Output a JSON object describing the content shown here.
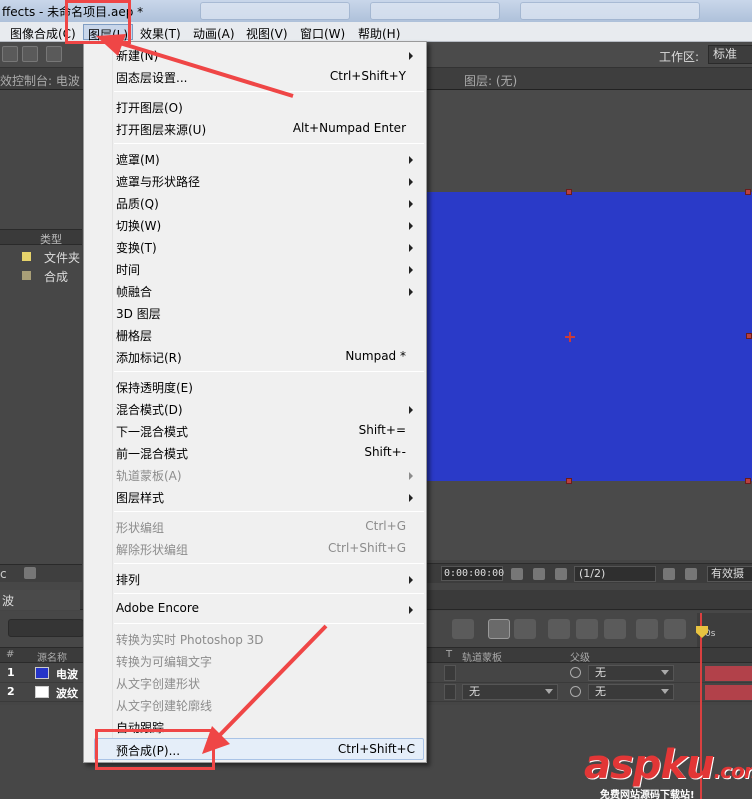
{
  "window": {
    "title": "ffects - 未命名项目.aep *"
  },
  "menubar": {
    "items": [
      "图像合成(C)",
      "图层(L)",
      "效果(T)",
      "动画(A)",
      "视图(V)",
      "窗口(W)",
      "帮助(H)"
    ]
  },
  "toolbar": {
    "workspace_label": "工作区:",
    "workspace_value": "标准"
  },
  "panels": {
    "effect_controls_label": "效控制台: 电波",
    "layer_label": "图层: (无)"
  },
  "project": {
    "type_header": "类型",
    "items": [
      {
        "name": "文件夹",
        "swatch": "#e6d36b"
      },
      {
        "name": "合成",
        "swatch": "#a99f78"
      }
    ],
    "footer_text": "c"
  },
  "viewer": {
    "timecode": "0:00:00:00",
    "resolution": "(1/2)",
    "camera_label": "有效摄"
  },
  "timeline": {
    "tab_label": "波",
    "headers": {
      "num": "#",
      "source_name": "源名称",
      "track_matte": "轨道蒙板",
      "parent": "父级",
      "t": "T"
    },
    "rows": [
      {
        "num": "1",
        "name": "电波",
        "color": "#2534c8",
        "matte": "",
        "parent": "无"
      },
      {
        "num": "2",
        "name": "波纹",
        "color": "#ffffff",
        "matte": "无",
        "parent": "无"
      }
    ],
    "ruler_label": "0s"
  },
  "layer_menu": {
    "items": [
      {
        "label": "新建(N)",
        "shortcut": "",
        "submenu": true,
        "disabled": false
      },
      {
        "label": "固态层设置...",
        "shortcut": "Ctrl+Shift+Y",
        "submenu": false,
        "disabled": false
      },
      {
        "sep": true
      },
      {
        "label": "打开图层(O)",
        "shortcut": "",
        "submenu": false,
        "disabled": false
      },
      {
        "label": "打开图层来源(U)",
        "shortcut": "Alt+Numpad Enter",
        "submenu": false,
        "disabled": false
      },
      {
        "sep": true
      },
      {
        "label": "遮罩(M)",
        "shortcut": "",
        "submenu": true,
        "disabled": false
      },
      {
        "label": "遮罩与形状路径",
        "shortcut": "",
        "submenu": true,
        "disabled": false
      },
      {
        "label": "品质(Q)",
        "shortcut": "",
        "submenu": true,
        "disabled": false
      },
      {
        "label": "切换(W)",
        "shortcut": "",
        "submenu": true,
        "disabled": false
      },
      {
        "label": "变换(T)",
        "shortcut": "",
        "submenu": true,
        "disabled": false
      },
      {
        "label": "时间",
        "shortcut": "",
        "submenu": true,
        "disabled": false
      },
      {
        "label": "帧融合",
        "shortcut": "",
        "submenu": true,
        "disabled": false
      },
      {
        "label": "3D 图层",
        "shortcut": "",
        "submenu": false,
        "disabled": false
      },
      {
        "label": "栅格层",
        "shortcut": "",
        "submenu": false,
        "disabled": false
      },
      {
        "label": "添加标记(R)",
        "shortcut": "Numpad *",
        "submenu": false,
        "disabled": false
      },
      {
        "sep": true
      },
      {
        "label": "保持透明度(E)",
        "shortcut": "",
        "submenu": false,
        "disabled": false
      },
      {
        "label": "混合模式(D)",
        "shortcut": "",
        "submenu": true,
        "disabled": false
      },
      {
        "label": "下一混合模式",
        "shortcut": "Shift+=",
        "submenu": false,
        "disabled": false
      },
      {
        "label": "前一混合模式",
        "shortcut": "Shift+-",
        "submenu": false,
        "disabled": false
      },
      {
        "label": "轨道蒙板(A)",
        "shortcut": "",
        "submenu": true,
        "disabled": true
      },
      {
        "label": "图层样式",
        "shortcut": "",
        "submenu": true,
        "disabled": false
      },
      {
        "sep": true
      },
      {
        "label": "形状编组",
        "shortcut": "Ctrl+G",
        "submenu": false,
        "disabled": true
      },
      {
        "label": "解除形状编组",
        "shortcut": "Ctrl+Shift+G",
        "submenu": false,
        "disabled": true
      },
      {
        "sep": true
      },
      {
        "label": "排列",
        "shortcut": "",
        "submenu": true,
        "disabled": false
      },
      {
        "sep": true
      },
      {
        "label": "Adobe Encore",
        "shortcut": "",
        "submenu": true,
        "disabled": false
      },
      {
        "sep": true
      },
      {
        "label": "转换为实时 Photoshop 3D",
        "shortcut": "",
        "submenu": false,
        "disabled": true
      },
      {
        "label": "转换为可编辑文字",
        "shortcut": "",
        "submenu": false,
        "disabled": true
      },
      {
        "label": "从文字创建形状",
        "shortcut": "",
        "submenu": false,
        "disabled": true
      },
      {
        "label": "从文字创建轮廓线",
        "shortcut": "",
        "submenu": false,
        "disabled": true
      },
      {
        "label": "自动跟踪...",
        "shortcut": "",
        "submenu": false,
        "disabled": false
      },
      {
        "label": "预合成(P)...",
        "shortcut": "Ctrl+Shift+C",
        "submenu": false,
        "disabled": false,
        "highlighted": true
      }
    ]
  },
  "watermark": {
    "logo_text": "aspku",
    "logo_domain": ".com",
    "subtitle": "免费网站源码下载站!"
  },
  "colors": {
    "accent_red": "#ef4646",
    "solid_blue": "#2a3ac8",
    "menu_bg": "#f0f0f0"
  }
}
